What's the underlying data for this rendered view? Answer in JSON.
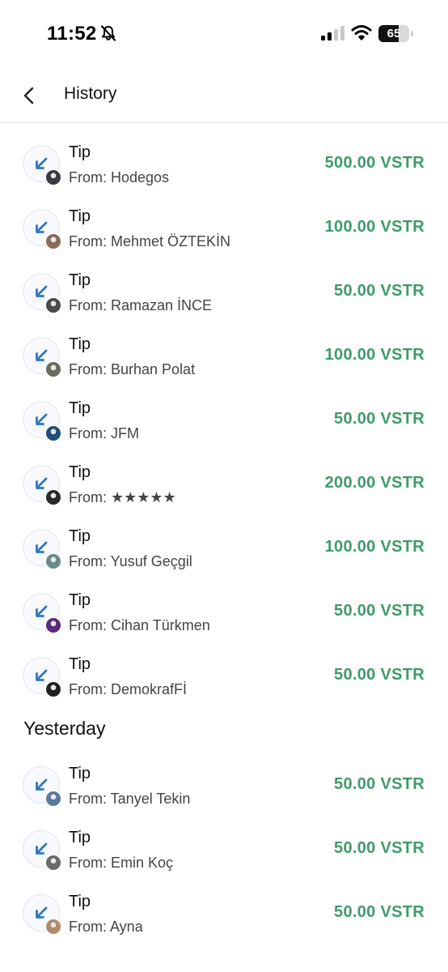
{
  "status_bar": {
    "time": "11:52",
    "battery": "65",
    "battery_level": 0.65,
    "icons": [
      "bell-slash-icon",
      "signal-icon",
      "wifi-icon",
      "battery-icon"
    ]
  },
  "header": {
    "title": "History",
    "back_icon": "chevron-left-icon"
  },
  "colors": {
    "amount": "#3f9a6a",
    "arrow": "#2f79c4",
    "divider": "#dcdcdc"
  },
  "sections": [
    {
      "label": "",
      "items": [
        {
          "type": "Tip",
          "from": "From: Hodegos",
          "amount": "500.00 VSTR",
          "avatar_color": "#3a3a44"
        },
        {
          "type": "Tip",
          "from": "From: Mehmet ÖZTEKİN",
          "amount": "100.00 VSTR",
          "avatar_color": "#8a6a5a"
        },
        {
          "type": "Tip",
          "from": "From: Ramazan İNCE",
          "amount": "50.00 VSTR",
          "avatar_color": "#4a4a4a"
        },
        {
          "type": "Tip",
          "from": "From: Burhan Polat",
          "amount": "100.00 VSTR",
          "avatar_color": "#6b6b60"
        },
        {
          "type": "Tip",
          "from": "From: JFM",
          "amount": "50.00 VSTR",
          "avatar_color": "#1e4e78"
        },
        {
          "type": "Tip",
          "from": "From: ★★★★★",
          "amount": "200.00 VSTR",
          "avatar_color": "#2a2a2a"
        },
        {
          "type": "Tip",
          "from": "From: Yusuf Geçgil",
          "amount": "100.00 VSTR",
          "avatar_color": "#6a8a8a"
        },
        {
          "type": "Tip",
          "from": "From: Cihan Türkmen",
          "amount": "50.00 VSTR",
          "avatar_color": "#5a2a7a"
        },
        {
          "type": "Tip",
          "from": "From: DemokrafFİ",
          "amount": "50.00 VSTR",
          "avatar_color": "#222222"
        }
      ]
    },
    {
      "label": "Yesterday",
      "items": [
        {
          "type": "Tip",
          "from": "From: Tanyel Tekin",
          "amount": "50.00 VSTR",
          "avatar_color": "#5a7a9a"
        },
        {
          "type": "Tip",
          "from": "From: Emin Koç",
          "amount": "50.00 VSTR",
          "avatar_color": "#6a6a6a"
        },
        {
          "type": "Tip",
          "from": "From: Ayna",
          "amount": "50.00 VSTR",
          "avatar_color": "#b08a6a"
        }
      ]
    }
  ]
}
